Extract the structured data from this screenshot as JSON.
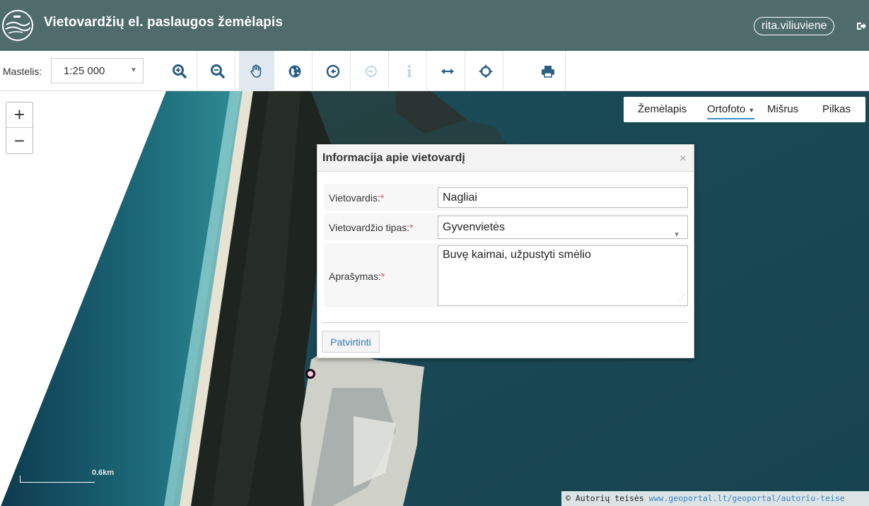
{
  "header": {
    "title": "Vietovardžių el. paslaugos žemėlapis",
    "username": "rita.viliuviene"
  },
  "toolbar": {
    "scale_label": "Mastelis:",
    "scale_value": "1:25 000",
    "tools": [
      {
        "name": "zoom-in-tool",
        "icon": "zoom-in-icon"
      },
      {
        "name": "zoom-out-tool",
        "icon": "zoom-out-icon"
      },
      {
        "name": "pan-tool",
        "icon": "hand-icon",
        "active": true
      },
      {
        "name": "full-extent-tool",
        "icon": "globe-icon"
      },
      {
        "name": "previous-extent-tool",
        "icon": "back-arrow-icon"
      },
      {
        "name": "next-extent-tool",
        "icon": "forward-arrow-icon",
        "disabled": true
      },
      {
        "name": "identify-tool",
        "icon": "info-icon",
        "disabled": true
      },
      {
        "name": "measure-tool",
        "icon": "measure-arrows-icon"
      },
      {
        "name": "locate-tool",
        "icon": "crosshair-icon"
      },
      {
        "name": "print-tool",
        "icon": "print-icon"
      }
    ]
  },
  "map": {
    "zoom_in": "+",
    "zoom_out": "−",
    "layers": [
      {
        "label": "Žemėlapis"
      },
      {
        "label": "Ortofoto",
        "active": true
      },
      {
        "label": "Mišrus"
      },
      {
        "label": "Pilkas"
      }
    ],
    "scale_bar": "0.6km",
    "attribution_prefix": "© Autorių teisės",
    "attribution_link": "www.geoportal.lt/geoportal/autoriu-teise"
  },
  "dialog": {
    "title": "Informacija apie vietovardį",
    "close": "×",
    "fields": {
      "name_label": "Vietovardis:",
      "name_value": "Nagliai",
      "type_label": "Vietovardžio tipas:",
      "type_value": "Gyvenvietės",
      "desc_label": "Aprašymas:",
      "desc_value": "Buvę kaimai, užpustyti smėlio"
    },
    "required_mark": "*",
    "confirm": "Patvirtinti"
  },
  "colors": {
    "header_bg": "#4f6b6c",
    "accent": "#2a7ab0",
    "active_tool": "#dfe9ef",
    "icon": "#2b5f82"
  }
}
